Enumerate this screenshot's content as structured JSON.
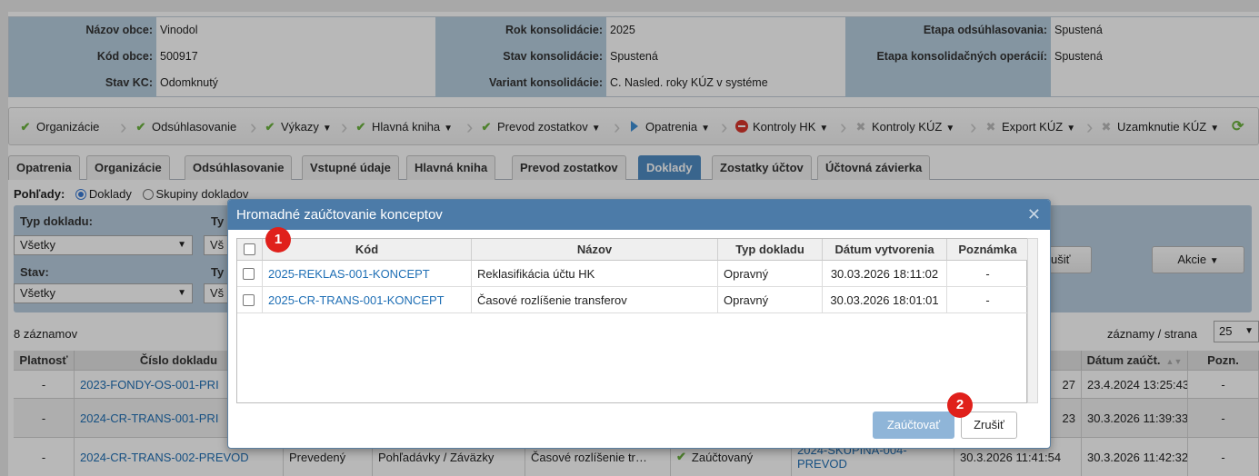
{
  "info": {
    "row1": {
      "l1": "Názov obce:",
      "v1": "Vinodol",
      "l2": "Rok konsolidácie:",
      "v2": "2025",
      "l3": "Etapa odsúhlasovania:",
      "v3": "Spustená"
    },
    "row2": {
      "l1": "Kód obce:",
      "v1": "500917",
      "l2": "Stav konsolidácie:",
      "v2": "Spustená",
      "l3": "Etapa konsolidačných operácií:",
      "v3": "Spustená"
    },
    "row3": {
      "l1": "Stav KC:",
      "v1": "Odomknutý",
      "l2": "Variant konsolidácie:",
      "v2": "C. Nasled. roky KÚZ v systéme"
    }
  },
  "toolbar": {
    "organizacie": "Organizácie",
    "odsuhlasovanie": "Odsúhlasovanie",
    "vykazy": "Výkazy",
    "hlavna_kniha": "Hlavná kniha",
    "prevod": "Prevod zostatkov",
    "opatrenia": "Opatrenia",
    "kontroly_hk": "Kontroly HK",
    "kontroly_kuz": "Kontroly KÚZ",
    "export": "Export KÚZ",
    "uzamknutie": "Uzamknutie KÚZ"
  },
  "tabs": [
    "Opatrenia",
    "Organizácie",
    "Odsúhlasovanie",
    "Vstupné údaje",
    "Hlavná kniha",
    "Prevod zostatkov",
    "Doklady",
    "Zostatky účtov",
    "Účtovná závierka"
  ],
  "active_tab": "Doklady",
  "views": {
    "label": "Pohľady:",
    "opt1": "Doklady",
    "opt2": "Skupiny dokladov"
  },
  "filter": {
    "typ_label": "Typ dokladu:",
    "typ_value": "Všetky",
    "typ2_label": "Ty",
    "typ2_value": "Vš",
    "stav_label": "Stav:",
    "stav_value": "Všetky",
    "typ3_label": "Ty",
    "typ3_value": "Vš",
    "search_btn": "ušiť",
    "akcie": "Akcie"
  },
  "count_text": "8 záznamov",
  "per_page_label": "záznamy / strana",
  "per_page_value": "25",
  "grid": {
    "headers": {
      "platnost": "Platnosť",
      "cislo": "Číslo dokladu",
      "datum": "Dátum zaúčt.",
      "pozn": "Pozn."
    },
    "rows": [
      {
        "platnost": "-",
        "cislo": "2023-FONDY-OS-001-PRI",
        "vytv": "27",
        "datum": "23.4.2024 13:25:43",
        "pozn": "-"
      },
      {
        "platnost": "-",
        "cislo": "2024-CR-TRANS-001-PRI",
        "vytv": "23",
        "datum": "30.3.2026 11:39:33",
        "pozn": "-"
      },
      {
        "platnost": "-",
        "cislo": "2024-CR-TRANS-002-PREVOD",
        "stav": "Prevedený",
        "typ": "Pohľadávky / Záväzky",
        "nazov": "Časové rozlíšenie tr…",
        "zauct": "Zaúčtovaný",
        "skupina": "2024-SKUPINA-004-PREVOD",
        "vytv": "30.3.2026 11:41:54",
        "datum": "30.3.2026 11:42:32",
        "pozn": "-"
      }
    ]
  },
  "modal": {
    "title": "Hromadné zaúčtovanie konceptov",
    "headers": {
      "kod": "Kód",
      "nazov": "Názov",
      "typ": "Typ dokladu",
      "datum": "Dátum vytvorenia",
      "poznamka": "Poznámka"
    },
    "rows": [
      {
        "kod": "2025-REKLAS-001-KONCEPT",
        "nazov": "Reklasifikácia účtu HK",
        "typ": "Opravný",
        "datum": "30.03.2026 18:11:02",
        "poznamka": "-"
      },
      {
        "kod": "2025-CR-TRANS-001-KONCEPT",
        "nazov": "Časové rozlíšenie transferov",
        "typ": "Opravný",
        "datum": "30.03.2026 18:01:01",
        "poznamka": "-"
      }
    ],
    "btn_post": "Zaúčtovať",
    "btn_cancel": "Zrušiť"
  },
  "badges": {
    "b1": "1",
    "b2": "2"
  },
  "colors": {
    "accent": "#4c7ba8",
    "label_bg": "#b8cfe0",
    "active_tab": "#4f8dc4",
    "badge": "#e0201b",
    "check": "#6db33f"
  }
}
